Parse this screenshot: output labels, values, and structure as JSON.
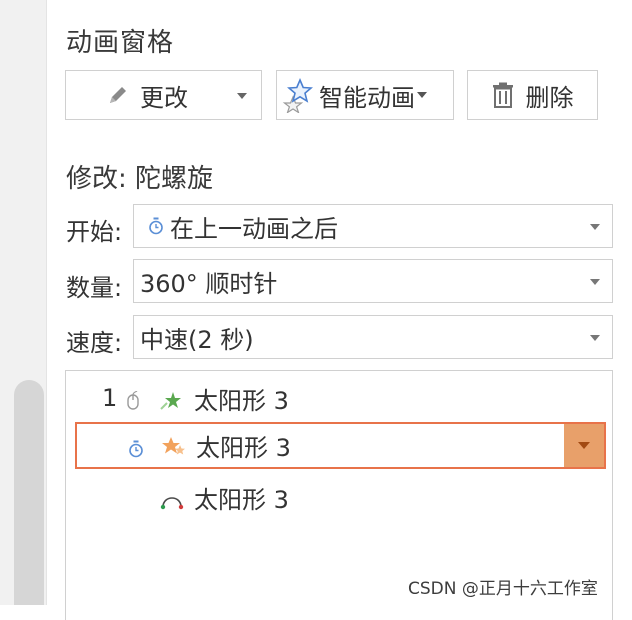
{
  "pane": {
    "title": "动画窗格"
  },
  "toolbar": {
    "change_label": "更改",
    "smart_label": "智能动画",
    "delete_label": "删除"
  },
  "modify": {
    "title": "修改: 陀螺旋",
    "start": {
      "label": "开始:",
      "value": "在上一动画之后"
    },
    "amount": {
      "label": "数量:",
      "value": "360° 顺时针"
    },
    "speed": {
      "label": "速度:",
      "value": "中速(2 秒)"
    }
  },
  "animation_list": [
    {
      "order": "1",
      "trigger_icon": "mouse-click-icon",
      "effect_icon": "entrance-star-icon",
      "name": "太阳形 3"
    },
    {
      "order": "",
      "trigger_icon": "clock-icon",
      "effect_icon": "emphasis-star-icon",
      "name": "太阳形 3",
      "selected": true
    },
    {
      "order": "",
      "trigger_icon": "",
      "effect_icon": "motion-path-arc-icon",
      "name": "太阳形 3"
    }
  ],
  "colors": {
    "selected_border": "#e8734a",
    "selected_dropdown": "#e8a06a",
    "clock_icon": "#5b8fd6"
  },
  "watermark": "CSDN @正月十六工作室"
}
